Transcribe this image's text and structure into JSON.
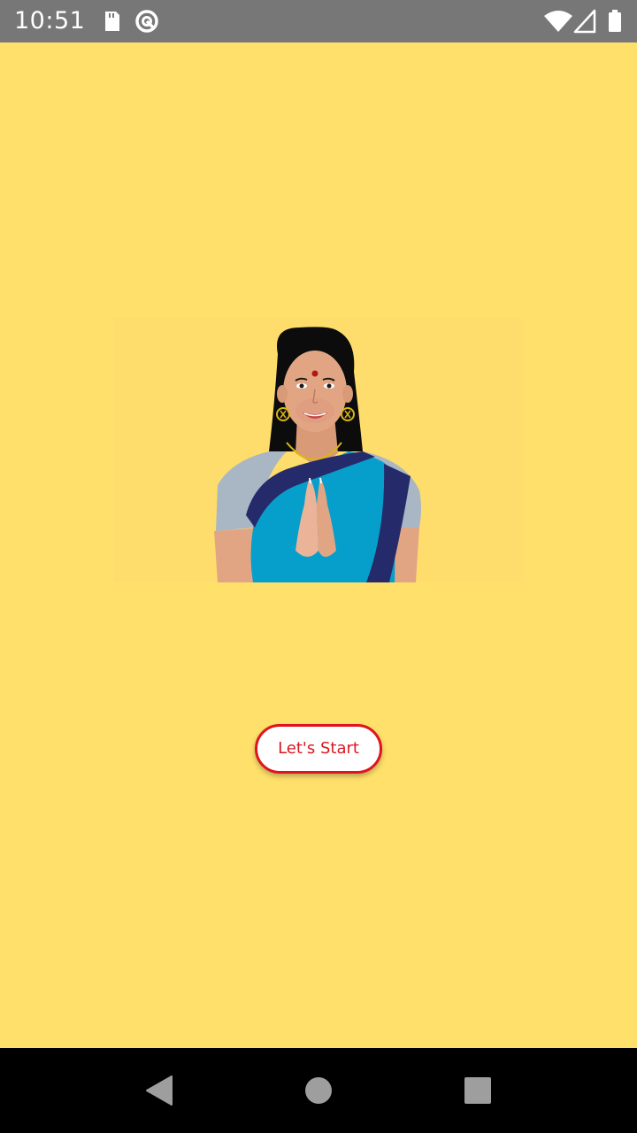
{
  "status_bar": {
    "time": "10:51",
    "icons": [
      "sd-card-icon",
      "sync-icon",
      "wifi-icon",
      "signal-icon",
      "battery-icon"
    ]
  },
  "main": {
    "illustration": "woman-namaste-illustration",
    "start_button_label": "Let's Start"
  },
  "nav_bar": {
    "icons": [
      "back-icon",
      "home-icon",
      "recents-icon"
    ]
  },
  "colors": {
    "background": "#ffe06b",
    "button_border": "#e0141e",
    "button_text": "#d81920",
    "status_bar": "#777777",
    "nav_bar": "#000000"
  }
}
